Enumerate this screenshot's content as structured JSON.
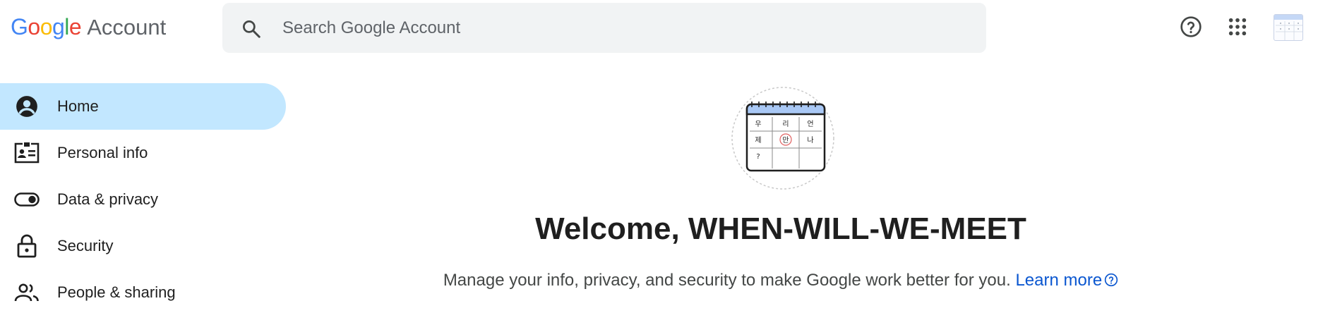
{
  "header": {
    "logo_letters": [
      "G",
      "o",
      "o",
      "g",
      "l",
      "e"
    ],
    "logo_account": "Account",
    "search_placeholder": "Search Google Account",
    "help_icon": "help-circle-icon",
    "apps_icon": "apps-grid-icon"
  },
  "sidebar": {
    "items": [
      {
        "label": "Home",
        "icon": "account-circle-icon",
        "active": true
      },
      {
        "label": "Personal info",
        "icon": "id-card-icon",
        "active": false
      },
      {
        "label": "Data & privacy",
        "icon": "toggle-icon",
        "active": false
      },
      {
        "label": "Security",
        "icon": "lock-icon",
        "active": false
      },
      {
        "label": "People & sharing",
        "icon": "people-icon",
        "active": false
      }
    ]
  },
  "main": {
    "illustration": {
      "cells": [
        "우",
        "리",
        "언",
        "제",
        "만",
        "나",
        "?",
        "",
        ""
      ]
    },
    "welcome": "Welcome, WHEN-WILL-WE-MEET",
    "subtitle": "Manage your info, privacy, and security to make Google work better for you.",
    "learn_more": "Learn more"
  },
  "colors": {
    "active_nav_bg": "#c2e7ff",
    "link": "#0b57d0",
    "search_bg": "#f1f3f4"
  }
}
